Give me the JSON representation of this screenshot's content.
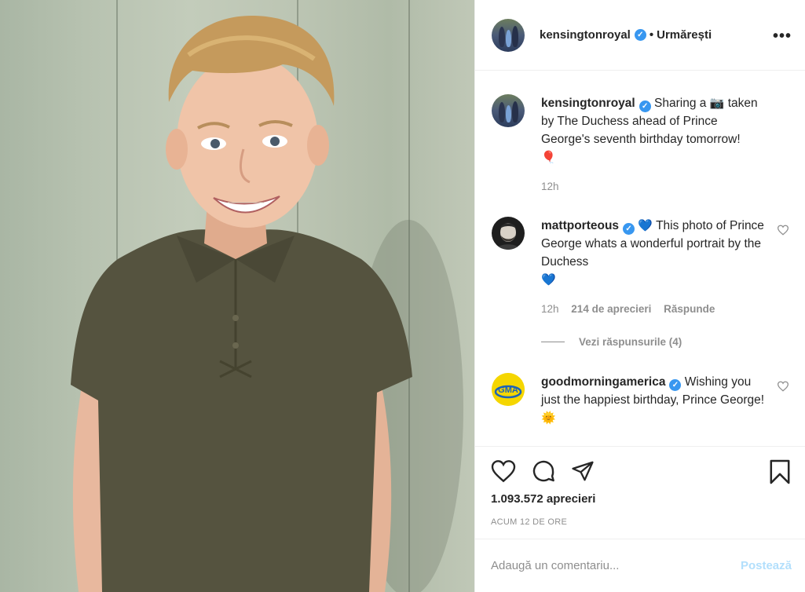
{
  "post": {
    "author": "kensingtonroyal",
    "follow_status": "Urmărești",
    "more_label": "•••",
    "likes": "1.093.572 aprecieri",
    "posted_ago": "ACUM 12 DE ORE"
  },
  "caption": {
    "user": "kensingtonroyal",
    "text_before_camera": "Sharing a",
    "camera_emoji": "📷",
    "text_after_camera": "taken by The Duchess ahead of Prince George's seventh birthday tomorrow!",
    "balloon_emoji": "🎈",
    "time": "12h"
  },
  "comments": [
    {
      "user": "mattporteous",
      "emoji_before": "💙",
      "text": "This photo of Prince George whats a wonderful portrait by the Duchess",
      "emoji_after": "💙",
      "time": "12h",
      "likes": "214 de aprecieri",
      "reply_label": "Răspunde",
      "view_replies": "Vezi răspunsurile (4)"
    },
    {
      "user": "goodmorningamerica",
      "avatar_text": "GMA",
      "text": "Wishing you just the happiest birthday, Prince George!",
      "emoji_after": "🌞"
    }
  ],
  "add_comment": {
    "placeholder": "Adaugă un comentariu...",
    "post_label": "Postează"
  },
  "colors": {
    "verified": "#3897f0",
    "post_button_disabled": "#b2dffc",
    "muted_text": "#8e8e8e",
    "gma_yellow": "#f5d600"
  },
  "icons": {
    "like": "heart-icon",
    "comment": "comment-bubble-icon",
    "share": "paper-plane-icon",
    "save": "bookmark-icon",
    "more": "ellipsis-icon",
    "verified": "verified-badge-icon"
  }
}
